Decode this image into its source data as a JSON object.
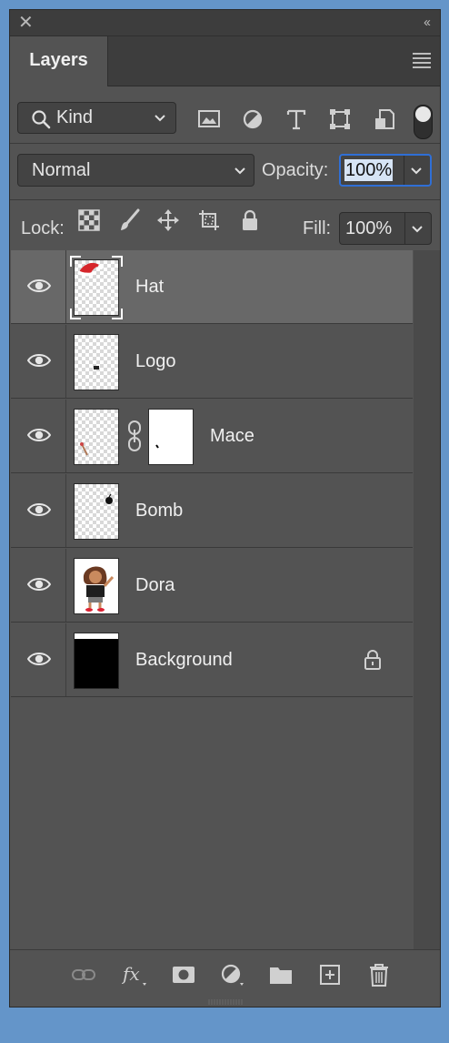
{
  "panel": {
    "tab_label": "Layers",
    "close_glyph": "✕",
    "collapse_glyph": "‹‹"
  },
  "filter": {
    "kind_label": "Kind",
    "icons": [
      "image-filter-icon",
      "adjustment-filter-icon",
      "type-filter-icon",
      "shape-filter-icon",
      "smart-object-filter-icon"
    ],
    "filter_toggle_on": true
  },
  "blend": {
    "mode": "Normal",
    "opacity_label": "Opacity:",
    "opacity_value": "100%"
  },
  "lock": {
    "label": "Lock:",
    "icons": [
      "lock-transparent-pixels-icon",
      "lock-image-pixels-icon",
      "lock-position-icon",
      "lock-artboard-icon",
      "lock-all-icon"
    ],
    "fill_label": "Fill:",
    "fill_value": "100%"
  },
  "layers": [
    {
      "name": "Hat",
      "selected": true,
      "thumb": "hat"
    },
    {
      "name": "Logo",
      "selected": false,
      "thumb": "logo"
    },
    {
      "name": "Mace",
      "selected": false,
      "thumb": "mace",
      "has_mask": true
    },
    {
      "name": "Bomb",
      "selected": false,
      "thumb": "bomb"
    },
    {
      "name": "Dora",
      "selected": false,
      "thumb": "dora"
    },
    {
      "name": "Background",
      "selected": false,
      "thumb": "black",
      "locked": true
    }
  ],
  "footer_icons": [
    "link-layers-icon",
    "fx-icon",
    "add-mask-icon",
    "adjustment-layer-icon",
    "new-group-icon",
    "new-layer-icon",
    "delete-layer-icon"
  ],
  "colors": {
    "app_background": "#6495c9",
    "panel": "#535353",
    "selected_row": "#686868",
    "focus_ring": "#2f6fd6"
  }
}
